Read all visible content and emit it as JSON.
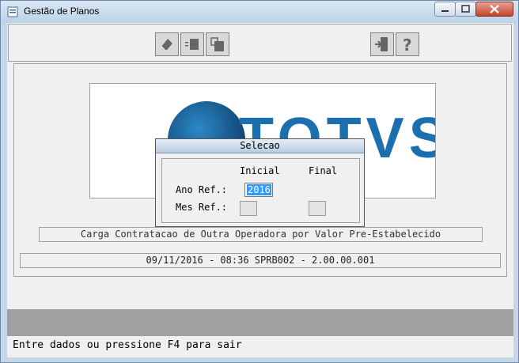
{
  "window": {
    "title": "Gestão de Planos"
  },
  "toolbar": {
    "buttons": [
      {
        "icon": "eraser-icon"
      },
      {
        "icon": "list-icon"
      },
      {
        "icon": "clipboard-icon"
      },
      {
        "icon": "exit-door-icon"
      },
      {
        "icon": "help-icon"
      }
    ]
  },
  "main": {
    "logo_text": "TOTVS",
    "description": "Carga Contratacao de Outra Operadora por Valor Pre-Estabelecido",
    "info": "09/11/2016 - 08:36  SPRB002 - 2.00.00.001"
  },
  "dialog": {
    "title": "Selecao",
    "col_inicial": "Inicial",
    "col_final": "Final",
    "ano_label": "Ano Ref.:",
    "mes_label": "Mes Ref.:",
    "ano_inicial_value": "2016"
  },
  "status": {
    "message": "Entre dados ou pressione F4 para sair"
  },
  "colors": {
    "accent": "#3399ff",
    "logo": "#1b6fae"
  }
}
